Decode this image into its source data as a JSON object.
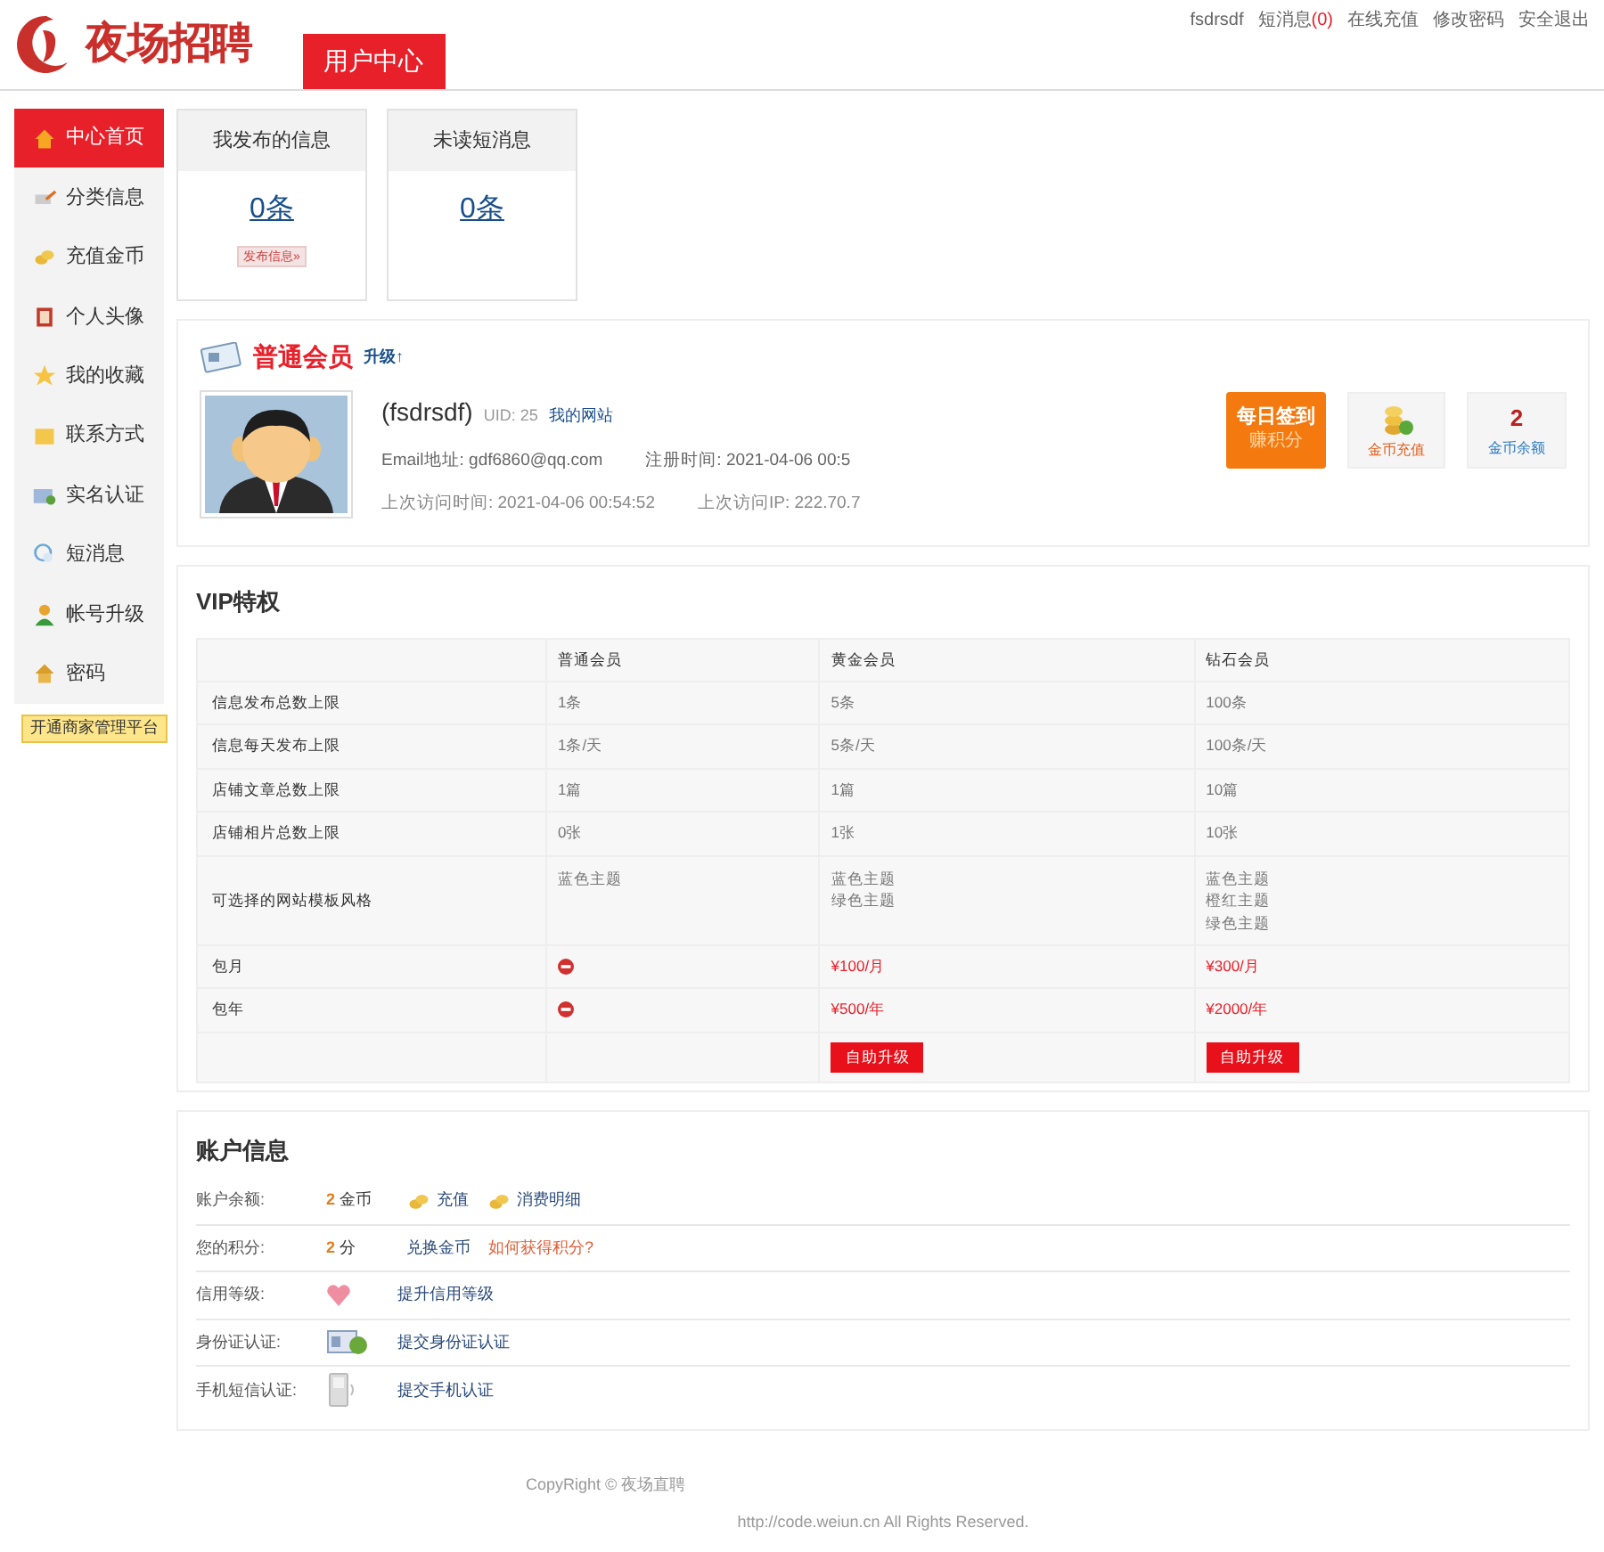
{
  "logo": {
    "text": "夜场招聘"
  },
  "header_tab": {
    "label": "用户中心",
    "selected": true
  },
  "top_links": [
    {
      "label": "fsdrsdf"
    },
    {
      "label": "短消息",
      "count": "(0)"
    },
    {
      "label": "在线充值"
    },
    {
      "label": "修改密码"
    },
    {
      "label": "安全退出"
    }
  ],
  "sidebar": {
    "items": [
      {
        "label": "中心首页",
        "selected": true
      },
      {
        "label": "分类信息",
        "selected": false
      },
      {
        "label": "充值金币",
        "selected": false
      },
      {
        "label": "个人头像",
        "selected": false
      },
      {
        "label": "我的收藏",
        "selected": false
      },
      {
        "label": "联系方式",
        "selected": false
      },
      {
        "label": "实名认证",
        "selected": false
      },
      {
        "label": "短消息",
        "selected": false
      },
      {
        "label": "帐号升级",
        "selected": false
      },
      {
        "label": "密码",
        "selected": false
      }
    ],
    "merchant_button": "开通商家管理平台"
  },
  "stats": [
    {
      "title": "我发布的信息",
      "value": "0条",
      "action": "发布信息»"
    },
    {
      "title": "未读短消息",
      "value": "0条"
    }
  ],
  "member": {
    "level": "普通会员",
    "upgrade": "升级↑",
    "name": "(fsdrsdf)",
    "uid": "UID: 25",
    "site_link": "我的网站",
    "email": "Email地址: gdf6860@qq.com",
    "register_time": "注册时间: 2021-04-06 00:5",
    "last_visit": "上次访问时间: 2021-04-06 00:54:52",
    "last_ip": "上次访问IP: 222.70.7",
    "tiles": [
      {
        "kind": "checkin",
        "title": "每日签到",
        "subtitle": "赚积分"
      },
      {
        "kind": "recharge",
        "label": "金币充值"
      },
      {
        "kind": "balance",
        "value": "2",
        "label": "金币余额"
      }
    ]
  },
  "vip": {
    "title": "VIP特权",
    "columns": [
      "普通会员",
      "黄金会员",
      "钻石会员"
    ],
    "rows": [
      {
        "label": "信息发布总数上限",
        "kind": "text",
        "cells": [
          {
            "available": true,
            "lines": [
              "1条"
            ]
          },
          {
            "available": true,
            "lines": [
              "5条"
            ]
          },
          {
            "available": true,
            "lines": [
              "100条"
            ]
          }
        ]
      },
      {
        "label": "信息每天发布上限",
        "kind": "text",
        "cells": [
          {
            "available": true,
            "lines": [
              "1条/天"
            ]
          },
          {
            "available": true,
            "lines": [
              "5条/天"
            ]
          },
          {
            "available": true,
            "lines": [
              "100条/天"
            ]
          }
        ]
      },
      {
        "label": "店铺文章总数上限",
        "kind": "text",
        "cells": [
          {
            "available": true,
            "lines": [
              "1篇"
            ]
          },
          {
            "available": true,
            "lines": [
              "1篇"
            ]
          },
          {
            "available": true,
            "lines": [
              "10篇"
            ]
          }
        ]
      },
      {
        "label": "店铺相片总数上限",
        "kind": "text",
        "cells": [
          {
            "available": true,
            "lines": [
              "0张"
            ]
          },
          {
            "available": true,
            "lines": [
              "1张"
            ]
          },
          {
            "available": true,
            "lines": [
              "10张"
            ]
          }
        ]
      },
      {
        "label": "可选择的网站模板风格",
        "kind": "text",
        "cells": [
          {
            "available": true,
            "lines": [
              "蓝色主题"
            ]
          },
          {
            "available": true,
            "lines": [
              "蓝色主题",
              "绿色主题"
            ]
          },
          {
            "available": true,
            "lines": [
              "蓝色主题",
              "橙红主题",
              "绿色主题"
            ]
          }
        ]
      },
      {
        "label": "包月",
        "kind": "price",
        "cells": [
          {
            "available": false
          },
          {
            "available": true,
            "lines": [
              "¥100/月"
            ]
          },
          {
            "available": true,
            "lines": [
              "¥300/月"
            ]
          }
        ]
      },
      {
        "label": "包年",
        "kind": "price",
        "cells": [
          {
            "available": false
          },
          {
            "available": true,
            "lines": [
              "¥500/年"
            ]
          },
          {
            "available": true,
            "lines": [
              "¥2000/年"
            ]
          }
        ]
      }
    ],
    "upgrade_buttons": [
      "自助升级",
      "自助升级"
    ]
  },
  "account": {
    "title": "账户信息",
    "rows": [
      {
        "label": "账户余额:",
        "value": "2",
        "unit": "金币",
        "links": [
          {
            "label": "充值"
          },
          {
            "label": "消费明细"
          }
        ]
      },
      {
        "label": "您的积分:",
        "value": "2",
        "unit": "分",
        "links": [
          {
            "label": "兑换金币"
          },
          {
            "label": "如何获得积分?",
            "color": "#e0603a"
          }
        ]
      },
      {
        "label": "信用等级:",
        "links": [
          {
            "label": "提升信用等级"
          }
        ]
      },
      {
        "label": "身份证认证:",
        "links": [
          {
            "label": "提交身份证认证"
          }
        ]
      },
      {
        "label": "手机短信认证:",
        "links": [
          {
            "label": "提交手机认证"
          }
        ]
      }
    ]
  },
  "footer": {
    "copyright": "CopyRight © 夜场直聘",
    "rights": "http://code.weiun.cn All Rights Reserved."
  }
}
